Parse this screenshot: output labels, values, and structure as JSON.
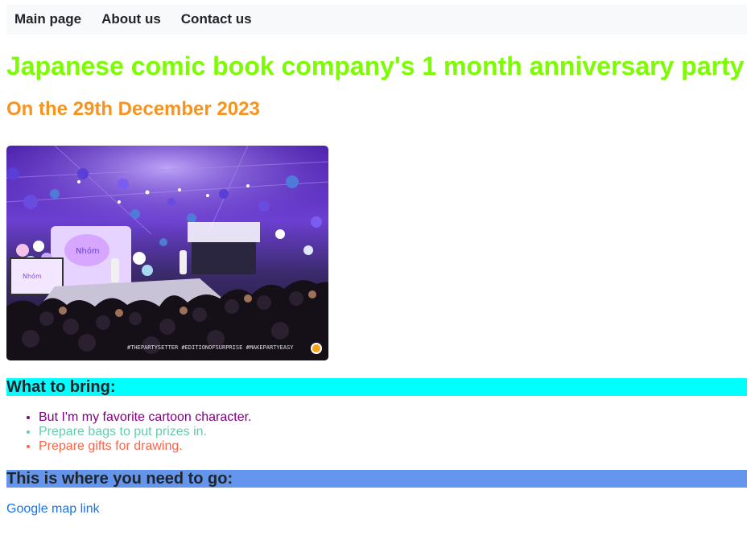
{
  "nav": {
    "items": [
      {
        "label": "Main page"
      },
      {
        "label": "About us"
      },
      {
        "label": "Contact us"
      }
    ]
  },
  "header": {
    "title": "Japanese comic book company's 1 month anniversary party",
    "subtitle": "On the 29th December 2023",
    "title_color": "#7cfc00",
    "subtitle_color": "#f7931e"
  },
  "photo": {
    "watermark": "#THEPARTYSETTER #EDITIONOFSURPRISE #MAKEPARTYEASY"
  },
  "bring": {
    "heading": "What to bring:",
    "heading_bg": "#00ffff",
    "items": [
      {
        "text": "But I'm my favorite cartoon character.",
        "color": "#800080"
      },
      {
        "text": "Prepare bags to put prizes in.",
        "color": "#66cdaa"
      },
      {
        "text": "Prepare gifts for drawing.",
        "color": "#ff6347"
      }
    ]
  },
  "location": {
    "heading": "This is where you need to go:",
    "heading_bg": "#6495ed",
    "link_text": "Google map link",
    "link_color": "#1a73e8"
  }
}
